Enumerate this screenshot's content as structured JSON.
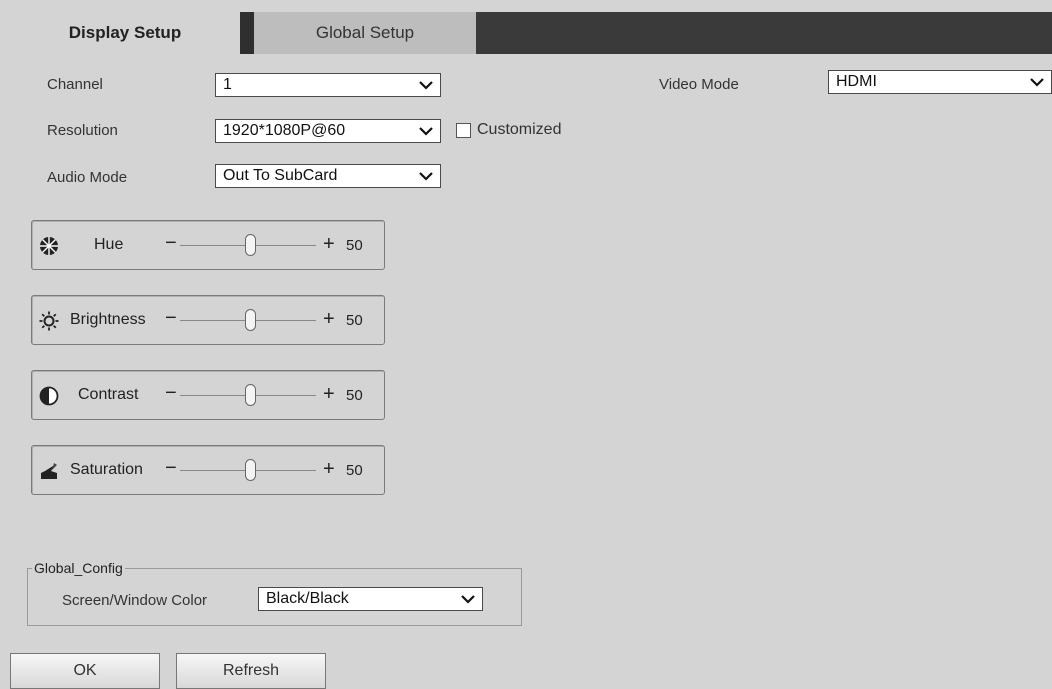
{
  "tabs": [
    {
      "label": "Display Setup"
    },
    {
      "label": "Global Setup"
    }
  ],
  "fields": {
    "channel": {
      "label": "Channel",
      "value": "1"
    },
    "resolution": {
      "label": "Resolution",
      "value": "1920*1080P@60"
    },
    "customized": {
      "label": "Customized",
      "checked": false
    },
    "audio_mode": {
      "label": "Audio Mode",
      "value": "Out To SubCard"
    },
    "video_mode": {
      "label": "Video Mode",
      "value": "HDMI"
    }
  },
  "sliders": [
    {
      "name": "Hue",
      "icon": "hue-icon",
      "minus": "−",
      "plus": "+",
      "value": "50",
      "level": 50
    },
    {
      "name": "Brightness",
      "icon": "brightness-icon",
      "minus": "−",
      "plus": "+",
      "value": "50",
      "level": 50
    },
    {
      "name": "Contrast",
      "icon": "contrast-icon",
      "minus": "−",
      "plus": "+",
      "value": "50",
      "level": 50
    },
    {
      "name": "Saturation",
      "icon": "saturation-icon",
      "minus": "−",
      "plus": "+",
      "value": "50",
      "level": 50
    }
  ],
  "global_config": {
    "legend": "Global_Config",
    "screen_window_color": {
      "label": "Screen/Window Color",
      "value": "Black/Black"
    }
  },
  "buttons": {
    "ok": "OK",
    "refresh": "Refresh"
  }
}
